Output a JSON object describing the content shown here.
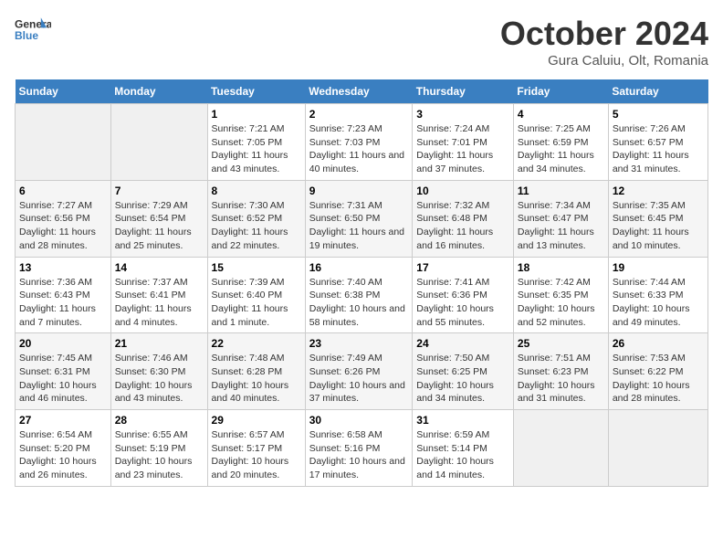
{
  "header": {
    "logo_line1": "General",
    "logo_line2": "Blue",
    "title": "October 2024",
    "subtitle": "Gura Caluiu, Olt, Romania"
  },
  "days_of_week": [
    "Sunday",
    "Monday",
    "Tuesday",
    "Wednesday",
    "Thursday",
    "Friday",
    "Saturday"
  ],
  "weeks": [
    [
      {
        "day": "",
        "empty": true
      },
      {
        "day": "",
        "empty": true
      },
      {
        "day": "1",
        "sunrise": "Sunrise: 7:21 AM",
        "sunset": "Sunset: 7:05 PM",
        "daylight": "Daylight: 11 hours and 43 minutes."
      },
      {
        "day": "2",
        "sunrise": "Sunrise: 7:23 AM",
        "sunset": "Sunset: 7:03 PM",
        "daylight": "Daylight: 11 hours and 40 minutes."
      },
      {
        "day": "3",
        "sunrise": "Sunrise: 7:24 AM",
        "sunset": "Sunset: 7:01 PM",
        "daylight": "Daylight: 11 hours and 37 minutes."
      },
      {
        "day": "4",
        "sunrise": "Sunrise: 7:25 AM",
        "sunset": "Sunset: 6:59 PM",
        "daylight": "Daylight: 11 hours and 34 minutes."
      },
      {
        "day": "5",
        "sunrise": "Sunrise: 7:26 AM",
        "sunset": "Sunset: 6:57 PM",
        "daylight": "Daylight: 11 hours and 31 minutes."
      }
    ],
    [
      {
        "day": "6",
        "sunrise": "Sunrise: 7:27 AM",
        "sunset": "Sunset: 6:56 PM",
        "daylight": "Daylight: 11 hours and 28 minutes."
      },
      {
        "day": "7",
        "sunrise": "Sunrise: 7:29 AM",
        "sunset": "Sunset: 6:54 PM",
        "daylight": "Daylight: 11 hours and 25 minutes."
      },
      {
        "day": "8",
        "sunrise": "Sunrise: 7:30 AM",
        "sunset": "Sunset: 6:52 PM",
        "daylight": "Daylight: 11 hours and 22 minutes."
      },
      {
        "day": "9",
        "sunrise": "Sunrise: 7:31 AM",
        "sunset": "Sunset: 6:50 PM",
        "daylight": "Daylight: 11 hours and 19 minutes."
      },
      {
        "day": "10",
        "sunrise": "Sunrise: 7:32 AM",
        "sunset": "Sunset: 6:48 PM",
        "daylight": "Daylight: 11 hours and 16 minutes."
      },
      {
        "day": "11",
        "sunrise": "Sunrise: 7:34 AM",
        "sunset": "Sunset: 6:47 PM",
        "daylight": "Daylight: 11 hours and 13 minutes."
      },
      {
        "day": "12",
        "sunrise": "Sunrise: 7:35 AM",
        "sunset": "Sunset: 6:45 PM",
        "daylight": "Daylight: 11 hours and 10 minutes."
      }
    ],
    [
      {
        "day": "13",
        "sunrise": "Sunrise: 7:36 AM",
        "sunset": "Sunset: 6:43 PM",
        "daylight": "Daylight: 11 hours and 7 minutes."
      },
      {
        "day": "14",
        "sunrise": "Sunrise: 7:37 AM",
        "sunset": "Sunset: 6:41 PM",
        "daylight": "Daylight: 11 hours and 4 minutes."
      },
      {
        "day": "15",
        "sunrise": "Sunrise: 7:39 AM",
        "sunset": "Sunset: 6:40 PM",
        "daylight": "Daylight: 11 hours and 1 minute."
      },
      {
        "day": "16",
        "sunrise": "Sunrise: 7:40 AM",
        "sunset": "Sunset: 6:38 PM",
        "daylight": "Daylight: 10 hours and 58 minutes."
      },
      {
        "day": "17",
        "sunrise": "Sunrise: 7:41 AM",
        "sunset": "Sunset: 6:36 PM",
        "daylight": "Daylight: 10 hours and 55 minutes."
      },
      {
        "day": "18",
        "sunrise": "Sunrise: 7:42 AM",
        "sunset": "Sunset: 6:35 PM",
        "daylight": "Daylight: 10 hours and 52 minutes."
      },
      {
        "day": "19",
        "sunrise": "Sunrise: 7:44 AM",
        "sunset": "Sunset: 6:33 PM",
        "daylight": "Daylight: 10 hours and 49 minutes."
      }
    ],
    [
      {
        "day": "20",
        "sunrise": "Sunrise: 7:45 AM",
        "sunset": "Sunset: 6:31 PM",
        "daylight": "Daylight: 10 hours and 46 minutes."
      },
      {
        "day": "21",
        "sunrise": "Sunrise: 7:46 AM",
        "sunset": "Sunset: 6:30 PM",
        "daylight": "Daylight: 10 hours and 43 minutes."
      },
      {
        "day": "22",
        "sunrise": "Sunrise: 7:48 AM",
        "sunset": "Sunset: 6:28 PM",
        "daylight": "Daylight: 10 hours and 40 minutes."
      },
      {
        "day": "23",
        "sunrise": "Sunrise: 7:49 AM",
        "sunset": "Sunset: 6:26 PM",
        "daylight": "Daylight: 10 hours and 37 minutes."
      },
      {
        "day": "24",
        "sunrise": "Sunrise: 7:50 AM",
        "sunset": "Sunset: 6:25 PM",
        "daylight": "Daylight: 10 hours and 34 minutes."
      },
      {
        "day": "25",
        "sunrise": "Sunrise: 7:51 AM",
        "sunset": "Sunset: 6:23 PM",
        "daylight": "Daylight: 10 hours and 31 minutes."
      },
      {
        "day": "26",
        "sunrise": "Sunrise: 7:53 AM",
        "sunset": "Sunset: 6:22 PM",
        "daylight": "Daylight: 10 hours and 28 minutes."
      }
    ],
    [
      {
        "day": "27",
        "sunrise": "Sunrise: 6:54 AM",
        "sunset": "Sunset: 5:20 PM",
        "daylight": "Daylight: 10 hours and 26 minutes."
      },
      {
        "day": "28",
        "sunrise": "Sunrise: 6:55 AM",
        "sunset": "Sunset: 5:19 PM",
        "daylight": "Daylight: 10 hours and 23 minutes."
      },
      {
        "day": "29",
        "sunrise": "Sunrise: 6:57 AM",
        "sunset": "Sunset: 5:17 PM",
        "daylight": "Daylight: 10 hours and 20 minutes."
      },
      {
        "day": "30",
        "sunrise": "Sunrise: 6:58 AM",
        "sunset": "Sunset: 5:16 PM",
        "daylight": "Daylight: 10 hours and 17 minutes."
      },
      {
        "day": "31",
        "sunrise": "Sunrise: 6:59 AM",
        "sunset": "Sunset: 5:14 PM",
        "daylight": "Daylight: 10 hours and 14 minutes."
      },
      {
        "day": "",
        "empty": true
      },
      {
        "day": "",
        "empty": true
      }
    ]
  ]
}
